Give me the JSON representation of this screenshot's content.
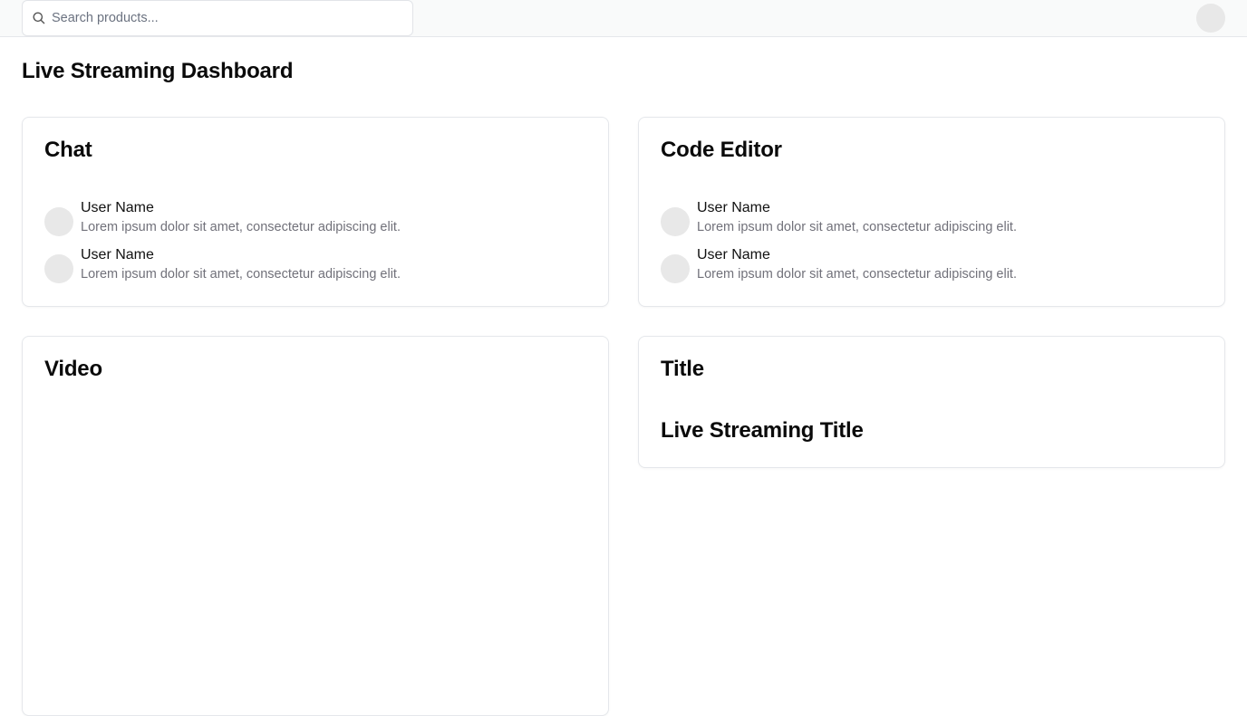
{
  "header": {
    "search": {
      "placeholder": "Search products...",
      "value": ""
    },
    "icons": {
      "search": "search-icon",
      "avatar": "user-avatar"
    }
  },
  "page": {
    "title": "Live Streaming Dashboard"
  },
  "cards": {
    "chat": {
      "title": "Chat",
      "messages": [
        {
          "user": "User Name",
          "text": "Lorem ipsum dolor sit amet, consectetur adipiscing elit."
        },
        {
          "user": "User Name",
          "text": "Lorem ipsum dolor sit amet, consectetur adipiscing elit."
        }
      ]
    },
    "code_editor": {
      "title": "Code Editor",
      "messages": [
        {
          "user": "User Name",
          "text": "Lorem ipsum dolor sit amet, consectetur adipiscing elit."
        },
        {
          "user": "User Name",
          "text": "Lorem ipsum dolor sit amet, consectetur adipiscing elit."
        }
      ]
    },
    "video": {
      "title": "Video"
    },
    "title": {
      "title": "Title",
      "stream_title": "Live Streaming Title"
    }
  },
  "colors": {
    "border": "#e5e7eb",
    "muted_text": "#71717a",
    "avatar_bg": "#e8e8e8",
    "topbar_bg": "#f9fafa"
  }
}
